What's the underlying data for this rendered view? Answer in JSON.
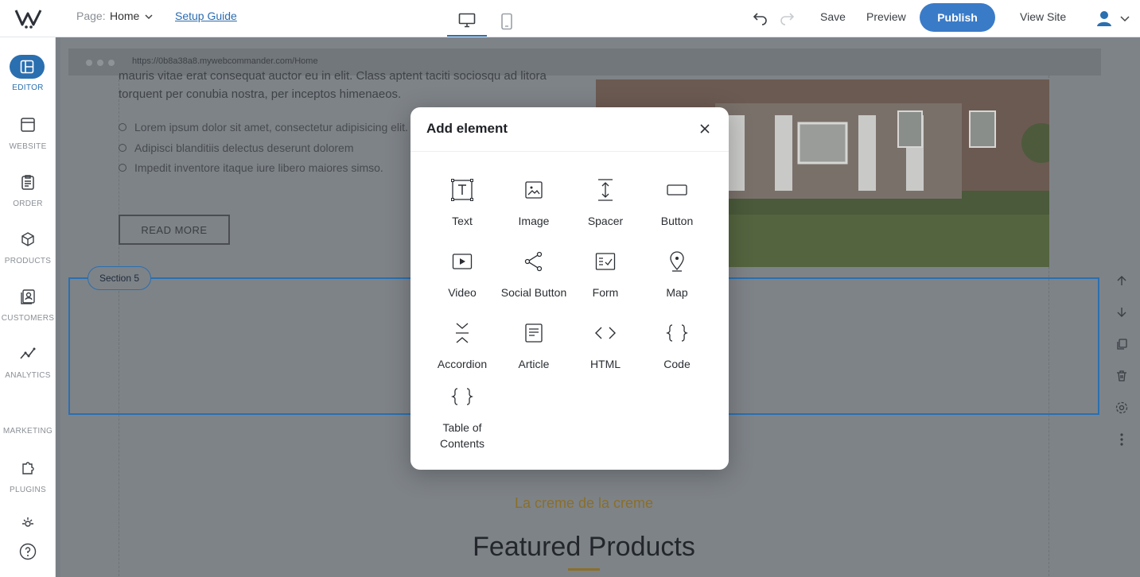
{
  "topbar": {
    "page_label": "Page:",
    "page_name": "Home",
    "setup_guide": "Setup Guide",
    "save": "Save",
    "preview": "Preview",
    "publish": "Publish",
    "view_site": "View Site"
  },
  "sidebar": {
    "items": [
      {
        "label": "EDITOR",
        "icon": "layout-icon"
      },
      {
        "label": "WEBSITE",
        "icon": "browser-icon"
      },
      {
        "label": "ORDER",
        "icon": "clipboard-icon"
      },
      {
        "label": "PRODUCTS",
        "icon": "cube-icon"
      },
      {
        "label": "CUSTOMERS",
        "icon": "contacts-icon"
      },
      {
        "label": "ANALYTICS",
        "icon": "chart-line-icon"
      }
    ],
    "marketing": "MARKETING",
    "plugins": "PLUGINS"
  },
  "canvas": {
    "url": "https://0b8a38a8.mywebcommander.com/Home",
    "text_line1": "mauris vitae erat consequat auctor eu in elit. Class aptent taciti sociosqu ad litora",
    "text_line2": "torquent per conubia nostra, per inceptos himenaeos.",
    "bullets": [
      "Lorem ipsum dolor sit amet, consectetur adipisicing elit.",
      "Adipisci blanditiis delectus deserunt dolorem",
      "Impedit inventore itaque iure libero maiores simso."
    ],
    "read_more": "READ MORE",
    "section_tag": "Section 5",
    "tagline": "La creme de la creme",
    "featured": "Featured Products"
  },
  "modal": {
    "title": "Add element",
    "elements": [
      {
        "label": "Text",
        "icon": "text-icon"
      },
      {
        "label": "Image",
        "icon": "image-icon"
      },
      {
        "label": "Spacer",
        "icon": "spacer-icon"
      },
      {
        "label": "Button",
        "icon": "button-icon"
      },
      {
        "label": "Video",
        "icon": "video-icon"
      },
      {
        "label": "Social Button",
        "icon": "share-icon"
      },
      {
        "label": "Form",
        "icon": "form-icon"
      },
      {
        "label": "Map",
        "icon": "map-pin-icon"
      },
      {
        "label": "Accordion",
        "icon": "accordion-icon"
      },
      {
        "label": "Article",
        "icon": "article-icon"
      },
      {
        "label": "HTML",
        "icon": "html-icon"
      },
      {
        "label": "Code",
        "icon": "code-icon"
      },
      {
        "label": "Table of Contents",
        "icon": "toc-icon"
      }
    ]
  },
  "colors": {
    "accent": "#2a6fb0",
    "publish": "#3a7bc8",
    "overlay": "#7e8388",
    "tagline": "#8a6f2a"
  }
}
